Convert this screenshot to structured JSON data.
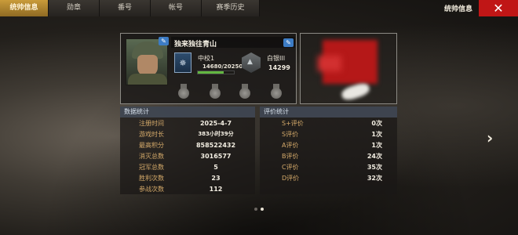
{
  "tabs": [
    {
      "label": "统帅信息",
      "active": true
    },
    {
      "label": "勋章",
      "active": false
    },
    {
      "label": "番号",
      "active": false
    },
    {
      "label": "帐号",
      "active": false
    },
    {
      "label": "赛季历史",
      "active": false
    }
  ],
  "header": {
    "title": "统帅信息",
    "close_label": "✕"
  },
  "profile": {
    "name": "独来独往青山",
    "rank_name": "中校1",
    "xp_text": "14680/20250",
    "xp_fraction": 0.725,
    "league_name": "白银III",
    "league_score": "14299",
    "edit_icon": "pencil-icon",
    "rank_icon": "✵"
  },
  "data_stats": {
    "title": "数据统计",
    "rows": [
      {
        "label": "注册时间",
        "value": "2025-4-7"
      },
      {
        "label": "游戏时长",
        "value": "383小时39分"
      },
      {
        "label": "最高积分",
        "value": "858522432"
      },
      {
        "label": "消灭总数",
        "value": "3016577"
      },
      {
        "label": "冠军总数",
        "value": "5"
      },
      {
        "label": "胜利次数",
        "value": "23"
      },
      {
        "label": "参战次数",
        "value": "112"
      }
    ]
  },
  "rating_stats": {
    "title": "评价统计",
    "rows": [
      {
        "label": "S+评价",
        "value": "0次"
      },
      {
        "label": "S评价",
        "value": "1次"
      },
      {
        "label": "A评价",
        "value": "1次"
      },
      {
        "label": "B评价",
        "value": "24次"
      },
      {
        "label": "C评价",
        "value": "35次"
      },
      {
        "label": "D评价",
        "value": "32次"
      }
    ]
  },
  "pagination": {
    "current": 2,
    "total": 2
  },
  "next_arrow": "›"
}
